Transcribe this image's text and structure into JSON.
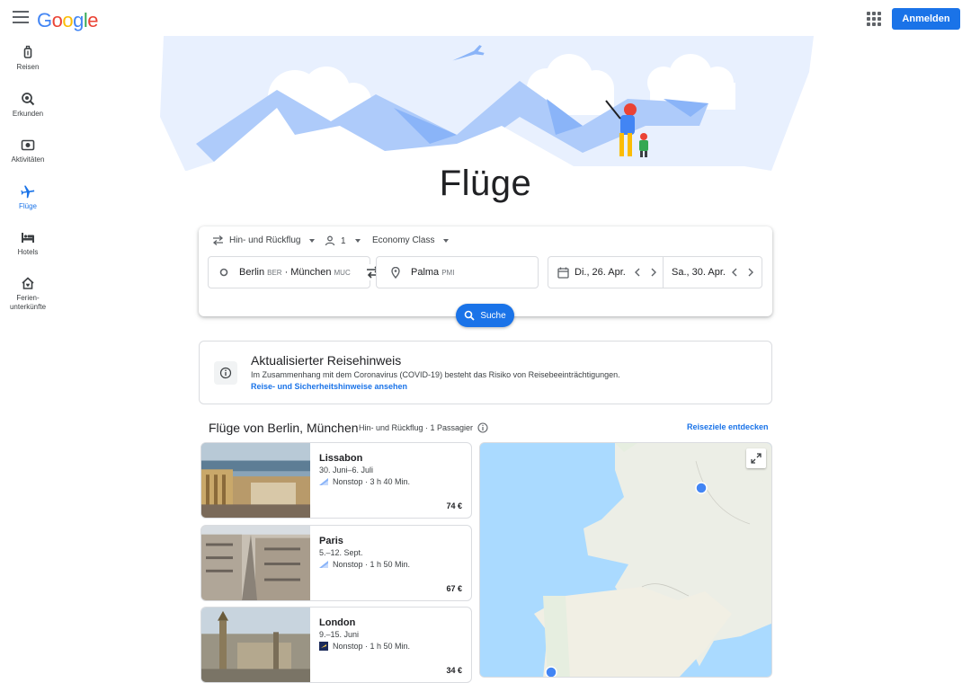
{
  "header": {
    "logo": "Google",
    "signin_label": "Anmelden"
  },
  "sidebar": {
    "items": [
      {
        "label": "Reisen",
        "icon": "luggage-icon"
      },
      {
        "label": "Erkunden",
        "icon": "explore-icon"
      },
      {
        "label": "Aktivitäten",
        "icon": "camera-icon"
      },
      {
        "label": "Flüge",
        "icon": "flight-icon",
        "active": true
      },
      {
        "label": "Hotels",
        "icon": "bed-icon"
      },
      {
        "label": "Ferien-",
        "label2": "unterkünfte",
        "icon": "house-icon"
      }
    ]
  },
  "page_title": "Flüge",
  "search": {
    "trip_type": "Hin- und Rückflug",
    "passengers": "1",
    "cabin_class": "Economy Class",
    "origin_city1": "Berlin",
    "origin_code1": "BER",
    "origin_sep": "·",
    "origin_city2": "München",
    "origin_code2": "MUC",
    "destination_city": "Palma",
    "destination_code": "PMI",
    "depart_date": "Di., 26. Apr.",
    "return_date": "Sa., 30. Apr.",
    "search_label": "Suche"
  },
  "notice": {
    "title": "Aktualisierter Reisehinweis",
    "text": "Im Zusammenhang mit dem Coronavirus (COVID-19) besteht das Risiko von Reisebeeinträchtigungen.",
    "link": "Reise- und Sicherheitshinweise ansehen"
  },
  "results": {
    "title": "Flüge von Berlin, München",
    "subtitle": "Hin- und Rückflug · 1 Passagier",
    "discover_link": "Reiseziele entdecken",
    "destinations": [
      {
        "city": "Lissabon",
        "dates": "30. Juni–6. Juli",
        "stops": "Nonstop · 3 h 40 Min.",
        "price": "74 €"
      },
      {
        "city": "Paris",
        "dates": "5.–12. Sept.",
        "stops": "Nonstop · 1 h 50 Min.",
        "price": "67 €"
      },
      {
        "city": "London",
        "dates": "9.–15. Juni",
        "stops": "Nonstop · 1 h 50 Min.",
        "price": "34 €"
      }
    ]
  },
  "colors": {
    "accent": "#1a73e8",
    "text": "#202124",
    "border": "#dadce0"
  }
}
